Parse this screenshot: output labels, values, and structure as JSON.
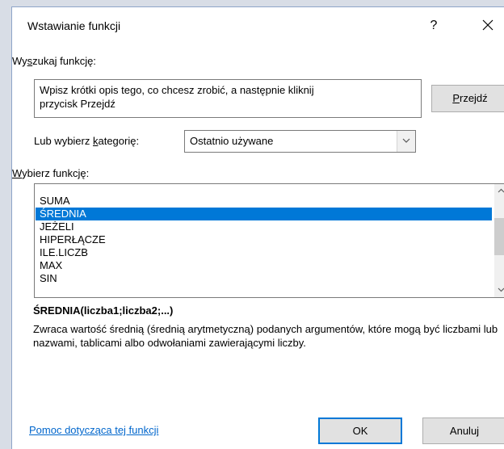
{
  "window": {
    "title": "Wstawianie funkcji",
    "help_glyph": "?",
    "close_glyph": "✕"
  },
  "search": {
    "label_pre": "Wy",
    "label_u": "s",
    "label_post": "zukaj funkcję:",
    "text_line1": "Wpisz krótki opis tego, co chcesz zrobić, a następnie kliknij",
    "text_line2": "przycisk Przejdź",
    "go_button": "Przejdź"
  },
  "category": {
    "label_pre": "Lub wybierz ",
    "label_u": "k",
    "label_post": "ategorię:",
    "selected": "Ostatnio używane"
  },
  "functions": {
    "label_u": "W",
    "label_post": "ybierz funkcję:",
    "items": [
      "SUMA",
      "ŚREDNIA",
      "JEŻELI",
      "HIPERŁĄCZE",
      "ILE.LICZB",
      "MAX",
      "SIN"
    ],
    "selected_index": 1
  },
  "details": {
    "signature": "ŚREDNIA(liczba1;liczba2;...)",
    "description": "Zwraca wartość średnią (średnią arytmetyczną) podanych argumentów, które mogą być liczbami lub nazwami, tablicami albo odwołaniami zawierającymi liczby."
  },
  "footer": {
    "help_link": "Pomoc dotycząca tej funkcji",
    "ok_button": "OK",
    "cancel_button": "Anuluj"
  },
  "colors": {
    "selection": "#0078d7",
    "link": "#0066cc",
    "button_face": "#e1e1e1"
  },
  "icons": {
    "select_arrow": "chevron-down-icon",
    "scroll_up": "chevron-up-icon",
    "scroll_down": "chevron-down-icon"
  }
}
